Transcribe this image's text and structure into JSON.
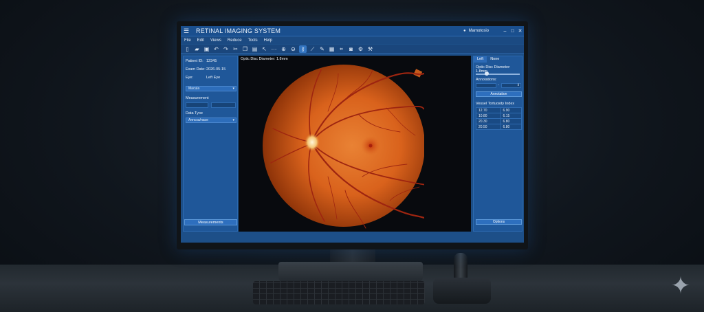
{
  "app": {
    "title": "RETINAL IMAGING SYSTEM",
    "user_label": "Mamotosio",
    "window_controls": [
      "–",
      "□",
      "✕"
    ]
  },
  "menu": [
    "File",
    "Edit",
    "Views",
    "Reduce",
    "Tools",
    "Help"
  ],
  "toolbar_icons": [
    "new-icon",
    "open-folder-icon",
    "save-icon",
    "undo-icon",
    "redo-icon",
    "cut-icon",
    "copy-icon",
    "paste-icon",
    "pointer-icon",
    "ellipsis-icon",
    "zoom-in-icon",
    "zoom-out-icon",
    "key-icon",
    "dropper-icon",
    "brush-icon",
    "image-icon",
    "crop-icon",
    "camera-icon",
    "settings-icon",
    "tools-icon"
  ],
  "left_panel": {
    "patient_id_label": "Patient ID:",
    "patient_id": "12345",
    "exam_date_label": "Exam Date:",
    "exam_date": "2026-05-15",
    "eye_label": "Eye:",
    "eye": "Left Eye",
    "view_select": "Macula",
    "measurement_label": "Measurement",
    "data_type_label": "Data Tyoe",
    "data_type_select": "Anncsa/nace",
    "measurements_button": "Measurements"
  },
  "viewer": {
    "caption": "Optic Disc Diameter: 1.8mm"
  },
  "right_panel": {
    "tabs": [
      "Left",
      "None"
    ],
    "optic_disc_label": "Optic Disc Diameter: 1.8mm",
    "slider_level": 0.25,
    "annotations_label": "Annotations:",
    "spin_separator": "-",
    "annotation_button": "Annotation",
    "tortuosity_title": "Vessel Tortuosity Index",
    "tortuosity_rows": [
      [
        "12.70",
        "6.90"
      ],
      [
        "10.80",
        "6.15"
      ],
      [
        "20.30",
        "6.80"
      ],
      [
        "20.50",
        "6.80"
      ]
    ],
    "options_button": "Options"
  },
  "colors": {
    "app_blue": "#1f5799",
    "fundus_orange": "#d9621c",
    "vessel_red": "#9e2510"
  }
}
